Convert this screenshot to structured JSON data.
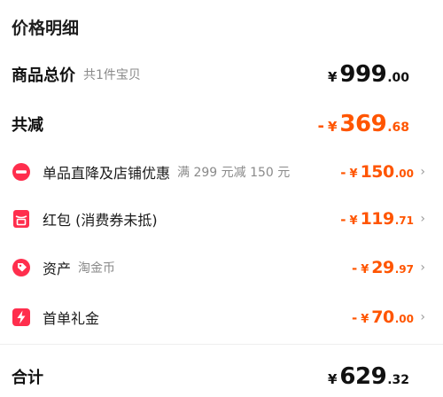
{
  "title": "价格明细",
  "goods_total": {
    "label": "商品总价",
    "sub": "共1件宝贝",
    "currency": "¥",
    "int": "999",
    "dec": ".00"
  },
  "reduction": {
    "label": "共减",
    "minus": "-",
    "currency": "¥",
    "int": "369",
    "dec": ".68"
  },
  "items": [
    {
      "label": "单品直降及店铺优惠",
      "sub": "满 299 元减 150 元",
      "minus": "-",
      "currency": "¥",
      "int": "150",
      "dec": ".00",
      "icon": "discount-icon"
    },
    {
      "label": "红包 (消费券未抵)",
      "sub": "",
      "minus": "-",
      "currency": "¥",
      "int": "119",
      "dec": ".71",
      "icon": "red-packet-icon"
    },
    {
      "label": "资产",
      "sub": "淘金币",
      "minus": "-",
      "currency": "¥",
      "int": "29",
      "dec": ".97",
      "icon": "tag-icon"
    },
    {
      "label": "首单礼金",
      "sub": "",
      "minus": "-",
      "currency": "¥",
      "int": "70",
      "dec": ".00",
      "icon": "lightning-icon"
    }
  ],
  "total": {
    "label": "合计",
    "currency": "¥",
    "int": "629",
    "dec": ".32"
  },
  "colors": {
    "accent": "#ff5500",
    "icon_red": "#ff2e4d"
  }
}
